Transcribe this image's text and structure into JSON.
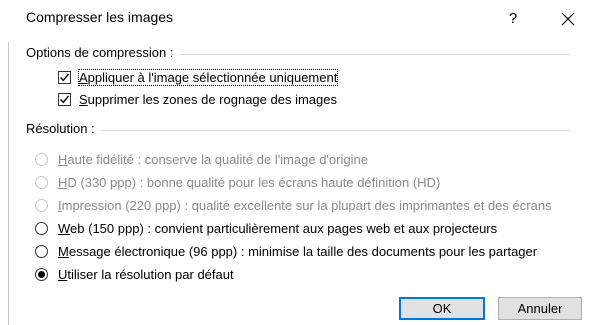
{
  "window": {
    "title": "Compresser les images",
    "help_label": "?"
  },
  "compression": {
    "group_label": "Options de compression :",
    "options": [
      {
        "label_first": "A",
        "label_rest": "ppliquer à l'image sélectionnée uniquement",
        "checked": true
      },
      {
        "label_first": "S",
        "label_rest": "upprimer les zones de rognage des images",
        "checked": true
      }
    ]
  },
  "resolution": {
    "group_label": "Résolution :",
    "options": [
      {
        "label_first": "H",
        "label_rest": "aute fidélité : conserve la qualité de l'image d'origine",
        "enabled": false,
        "selected": false
      },
      {
        "label_first": "H",
        "label_rest": "D (330 ppp) : bonne qualité pour les écrans haute définition (HD)",
        "enabled": false,
        "selected": false
      },
      {
        "label_first": "I",
        "label_rest": "mpression (220 ppp) : qualité excellente sur la plupart des imprimantes et des écrans",
        "enabled": false,
        "selected": false
      },
      {
        "label_first": "W",
        "label_rest": "eb (150 ppp) : convient particulièrement aux pages web et aux projecteurs",
        "enabled": true,
        "selected": false
      },
      {
        "label_first": "M",
        "label_rest": "essage électronique (96 ppp) : minimise la taille des documents pour les partager",
        "enabled": true,
        "selected": false
      },
      {
        "label_first": "U",
        "label_rest": "tiliser la résolution par défaut",
        "enabled": true,
        "selected": true
      }
    ]
  },
  "buttons": {
    "ok_label": "OK",
    "cancel_label": "Annuler"
  },
  "colors": {
    "default_button_border": "#0078d7",
    "disabled_text": "#8a8a8a"
  }
}
